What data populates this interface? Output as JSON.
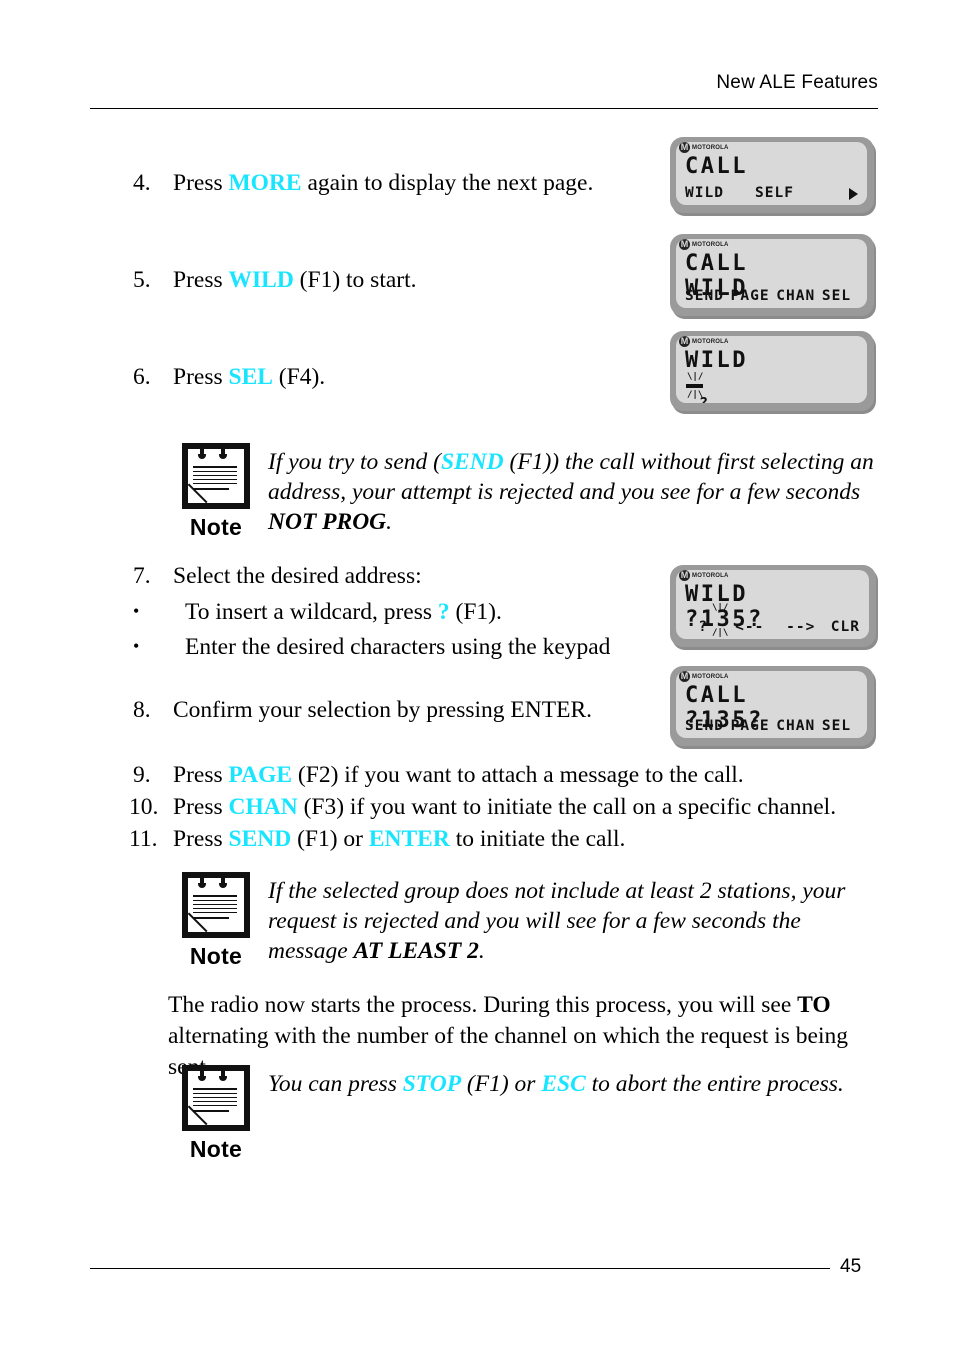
{
  "header": {
    "title": "New ALE Features"
  },
  "footer": {
    "page_number": "45"
  },
  "steps": {
    "s4": {
      "num": "4.",
      "pre": "Press ",
      "key": "MORE",
      "post": " again to display the next page."
    },
    "s5": {
      "num": "5.",
      "pre": "Press ",
      "key": "WILD",
      "post": " (F1) to start."
    },
    "s6": {
      "num": "6.",
      "pre": "Press ",
      "key": "SEL",
      "post": " (F4)."
    },
    "s7": {
      "num": "7.",
      "text": "Select the desired address:"
    },
    "s7b1": {
      "bullet": "•",
      "pre": "To insert a wildcard, press ",
      "key": "?",
      "post": " (F1)."
    },
    "s7b2": {
      "bullet": "•",
      "text": "Enter the desired characters using the keypad"
    },
    "s8": {
      "num": "8.",
      "text": "Confirm your selection by pressing ENTER."
    },
    "s9": {
      "num": "9.",
      "pre": "Press ",
      "key": "PAGE",
      "post": " (F2) if you want to attach a message to the call."
    },
    "s10": {
      "num": "10.",
      "pre": "Press ",
      "key": "CHAN",
      "post": " (F3) if you want to initiate the call on a specific channel."
    },
    "s11": {
      "num": "11.",
      "pre": "Press ",
      "key": "SEND",
      "mid": " (F1) or ",
      "key2": "ENTER",
      "post": " to initiate the call."
    }
  },
  "notes": {
    "note_label": "Note",
    "note1": {
      "part1": "If you try to send (",
      "key": "SEND",
      "part2": " (F1)) the call without first selecting an address, your attempt is rejected and you see for a few seconds ",
      "message": "NOT PROG",
      "part3": "."
    },
    "note2": {
      "part1": "If the selected group does not include at least 2 stations, your request is rejected and you will see for a few seconds the message ",
      "message": "AT LEAST 2",
      "part3": "."
    },
    "note3": {
      "part1": "You can press ",
      "key": "STOP",
      "part2": " (F1) or ",
      "key2": "ESC",
      "part3": " to abort the entire process."
    }
  },
  "body_paragraph": {
    "part1": "The radio now starts the process. During this process, you will see ",
    "bold": "TO",
    "part2": " alternating with the number of the channel on which the request is being sent."
  },
  "displays": {
    "brand": "MOTOROLA",
    "d1": {
      "line1": "CALL",
      "line2": "",
      "softkeys": [
        "WILD",
        "SELF"
      ],
      "more_arrow": "▶"
    },
    "d2": {
      "line1": "CALL",
      "line2": "WILD",
      "softkeys": [
        "SEND",
        "PAGE",
        "CHAN",
        "SEL"
      ]
    },
    "d3": {
      "line1": "WILD",
      "line2": "",
      "cursor_top": "\\|/",
      "cursor_bottom": "/|\\",
      "prompt": "?",
      "softkeys": []
    },
    "d4": {
      "line1": "WILD",
      "line2": "?135?",
      "cursor_top": "\\|/",
      "cursor_bottom": "/|\\",
      "softkeys": [
        "?",
        "<--",
        "-->",
        "CLR"
      ]
    },
    "d5": {
      "line1": "CALL",
      "line2": "?135?",
      "softkeys": [
        "SEND",
        "PAGE",
        "CHAN",
        "SEL"
      ]
    }
  },
  "colors": {
    "key_accent": "#19E5FF",
    "lcd_bezel": "#9a9a9a",
    "lcd_face": "#d9d9d9",
    "text": "#000000"
  }
}
